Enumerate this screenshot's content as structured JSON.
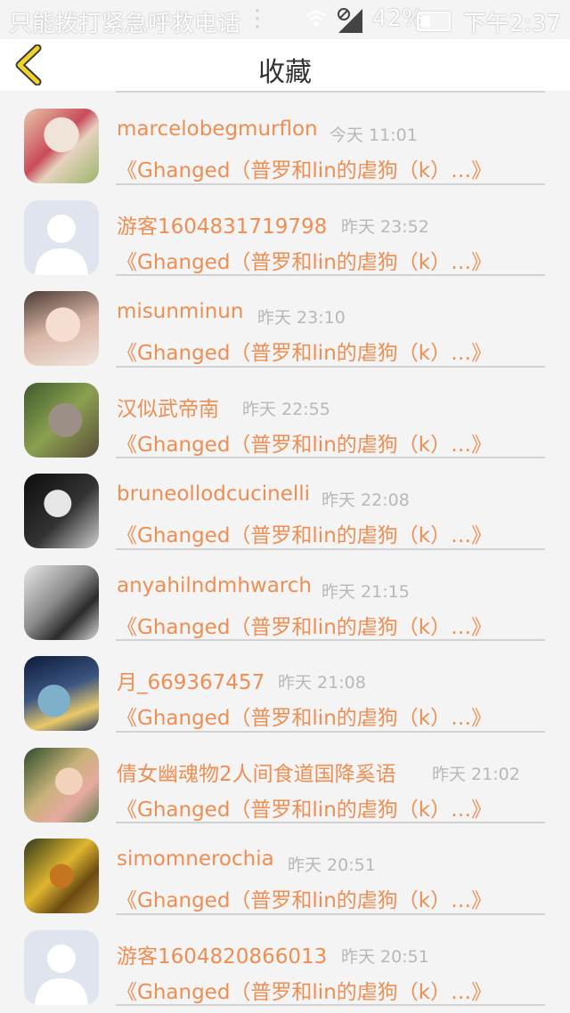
{
  "status_bar": {
    "carrier": "只能拨打紧急呼救电话",
    "battery": "42%",
    "time": "下午2:37"
  },
  "header": {
    "title": "收藏",
    "back_icon": "chevron-left-icon"
  },
  "colors": {
    "accent": "#ee8e52",
    "back_icon": "#f4d22c"
  },
  "items": [
    {
      "name": "marcelobegmurflon",
      "time": "今天 11:01",
      "content": "《Ghanged（普罗和lin的虐狗（k）…》",
      "avatar": "avatar-photo"
    },
    {
      "name": "游客1604831719798",
      "time": "昨天 23:52",
      "content": "《Ghanged（普罗和lin的虐狗（k）…》",
      "avatar": "default-avatar"
    },
    {
      "name": "misunminun",
      "time": "昨天 23:10",
      "content": "《Ghanged（普罗和lin的虐狗（k）…》",
      "avatar": "avatar-photo"
    },
    {
      "name": "汉似武帝南",
      "time": "昨天 22:55",
      "content": "《Ghanged（普罗和lin的虐狗（k）…》",
      "avatar": "avatar-photo"
    },
    {
      "name": "bruneollodcucinelli",
      "time": "昨天 22:08",
      "content": "《Ghanged（普罗和lin的虐狗（k）…》",
      "avatar": "avatar-photo"
    },
    {
      "name": "anyahilndmhwarch",
      "time": "昨天 21:15",
      "content": "《Ghanged（普罗和lin的虐狗（k）…》",
      "avatar": "avatar-photo"
    },
    {
      "name": "月_669367457",
      "time": "昨天 21:08",
      "content": "《Ghanged（普罗和lin的虐狗（k）…》",
      "avatar": "avatar-photo"
    },
    {
      "name": "倩女幽魂物2人间食道国降奚语",
      "time": "昨天 21:02",
      "content": "《Ghanged（普罗和lin的虐狗（k）…》",
      "avatar": "avatar-photo"
    },
    {
      "name": "simomnerochia",
      "time": "昨天 20:51",
      "content": "《Ghanged（普罗和lin的虐狗（k）…》",
      "avatar": "avatar-photo"
    },
    {
      "name": "游客1604820866013",
      "time": "昨天 20:51",
      "content": "《Ghanged（普罗和lin的虐狗（k）…》",
      "avatar": "default-avatar"
    }
  ]
}
